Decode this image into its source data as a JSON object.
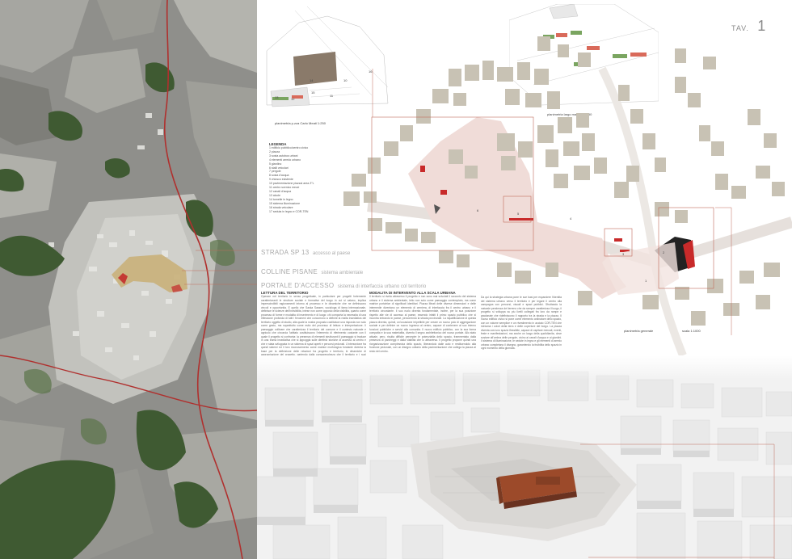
{
  "sheet": {
    "label": "TAV.",
    "number": "1"
  },
  "callouts": [
    {
      "title": "STRADA SP 13",
      "subtitle": "accesso al paese"
    },
    {
      "title": "COLLINE PISANE",
      "subtitle": "sistema ambientale"
    },
    {
      "title": "PORTALE D'ACCESSO",
      "subtitle": "sistema di interfaccia urbano col territorio"
    }
  ],
  "plans": {
    "left_caption": "planimetria p.zza Carlo Meati  1:250",
    "right_caption": "planimetria largo mazzini 1:250",
    "general_caption": "planimetria generale",
    "general_scale": "scala 1:1000"
  },
  "plan_numbers": [
    "14",
    "10",
    "16",
    "13",
    "15",
    "11",
    "12"
  ],
  "site_numbers": [
    "1",
    "2",
    "3",
    "4",
    "5",
    "6"
  ],
  "legend": {
    "title": "LEGENDA",
    "items": [
      "1 edificio pubblico/centro civico",
      "2 piazza",
      "3 sosta autobus urbani",
      "4 elementi arredo urbano",
      "5 giardino",
      "6 stalli veicolari",
      "7 pergole",
      "8 sosta d'acqua",
      "9 chiosco esistente",
      "10 pavimentazione piazzai area Z\"L",
      "11 centro scenico mezzi",
      "12 canali d'acqua",
      "13 alcole",
      "14 tornelle in legno",
      "15 sistema illuminazione",
      "16 strada veicolare",
      "17 seduta in legno e COR-TEN"
    ]
  },
  "text_columns": [
    {
      "heading": "LETTURA DEL TERRITORIO",
      "body": "Operare nel territorio in senso progettuale, in particolare per progetti fortemente caratterizzanti le strutture sociale e formative del luogo in cui si calano, implica imprescindibili ragionamenti intorno al processo e le dinamiche che ne definiscono vincoli e opportunita. E quello che Saska Sassen, sociologa di fama internazionale, definisce le scienze dell'invisibilita, intese non come opposto della visibilita, quanto come processo di forme e modalita di inserimento e di luogo: chi comporta la necessita di una riflessione profonda di tutti i fenomeni che concorrono a definire la realta insediativa del territorio oggetto di studio, alla quale la nostra proposta costituisce una risposta non solo come gesto, ma soprattutto come esito del processo di lettura e interpretazione. Il paesaggio collinare che caratterizza il territorio del comune e il contesto naturale e agricolo che circonda l'abitato costituiscono l'elemento di riferimento costante con il quale il progetto si confronta: la presenza di elementi strutturanti il paesaggio si traduce in una trama insediativa che si appoggia sulle direttrici storiche di accesso al centro e che e stata sviluppata in un sistema di spazi aperti e percorsi pedonali. L'intersezione fra questi sistemi ed il loro riconoscimento come matrice morfologica fondante diventa la base per la definizione delle relazioni fra progetto e territorio, le dinamiche di appropriazione del progetto, partendo dalla consapevolezza che il territorio e i suoi segni, difendendone le peculiarita e favorendone la fruizione e lo sviluppo."
    },
    {
      "heading": "MODALITA DI INTERVENTO ALLA SCALA URBANA",
      "body": "Il territorio si rivela attraverso il progetto e non sono mai scivolati il racconto del sistema urbano e il sistema ambientale, letto non solo come paesaggio contemplato, ma come matrice portatrice di significati identitari. Piazza Meati delle diverse dimensioni e delle intermedie diventano un elemento di cerniera, di interfaccia fra il centro urbano e il territorio circostante. Il suo ruolo diventa fondamentale, inoltre, per la sua posizione rispetto alle vie di accesso al paese, essendo infatti il primo spazio pubblico che si incontra entrando in paese, percorrendo la strada provinciale. La riqualificazione di questa piazza diventa, quindi, un'occasione irripetibile per creare un nuovo polo di aggregazione sociale e per definire un nuovo ingresso al centro, capace di contenere al suo interno funzioni pubbliche e servizi alla comunita. Il nuovo edificio pubblico, con la sua forma compatta e la sua materialita, diventa il segno architettonico del nuovo portale. Allo stato attuale, pero, risulta difficile percepire le potenzialita dello spazio, frammentato dalla presenza di parcheggi e dalla viabilita che lo attraversa. Il progetto propone quindi una riorganizzazione complessiva dello spazio, liberandolo dalle auto e restituendolo alla fruizione pedonale, con un disegno unitario della pavimentazione che collega la piazza al resto del centro."
    },
    {
      "heading": "",
      "body": "Da qui la strategia urbana pone le sue basi per espandere l'identita del sistema urbano verso il territorio e per legare il centro alla campagna con percorsi, visuali e spazi pubblici. Sfruttando la naturale pendenza del terreno che da sempre caratterizza il luogo, il progetto si sviluppa su piu livelli collegati fra loro da rampe e gradonate che ridefiniscono il rapporto tra la strada e la piazza. Il nuovo edificio civico si pone come elemento ordinatore dello spazio, con un volume semplice e un rivestimento in acciaio COR-TEN che richiama i colori della terra e delle coperture del borgo. La piazza diventa cosi uno spazio flessibile, capace di ospitare mercati, eventi, feste e manifestazioni, ma anche un luogo della quotidianita, dove sostare all'ombra delle pergole, vicino ai canali d'acqua e ai giardini. Il sistema di illuminazione, le sedute in legno e gli elementi di arredo urbano completano il disegno, garantendo la fruibilita dello spazio in ogni momento della giornata."
    }
  ],
  "colors": {
    "road": "#b0302e",
    "building_fill": "#c8c2b4",
    "accent_red": "#c82a2a",
    "corten": "#9c4a2a",
    "frame_line": "#c06a5a",
    "pink_plaza": "#f0dcd8"
  }
}
